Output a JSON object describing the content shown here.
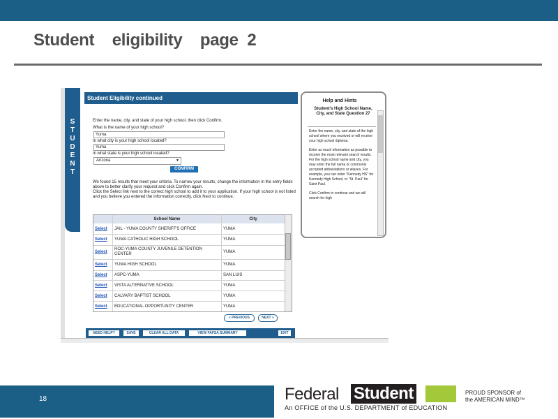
{
  "slide": {
    "title": "Student    eligibility    page  2",
    "page_number": "18"
  },
  "form": {
    "header": "Student Eligibility continued",
    "sidebar_letters": [
      "S",
      "T",
      "U",
      "D",
      "E",
      "N",
      "T"
    ],
    "instruction": "Enter the name, city, and state of your high school, then click Confirm.",
    "q_name": "What is the name of your high school?",
    "q_name_value": "Yuma",
    "q_city": "In what city is your high school located?",
    "q_city_value": "Yuma",
    "q_state": "In what state is your high school located?",
    "q_state_value": "Arizona",
    "confirm_label": "CONFIRM",
    "results_text": "We found 15 results that meet your criteria. To narrow your results, change the information in the entry fields above to better clarify your request and click Confirm again.",
    "select_help": "Click the Select link next to the correct high school to add it to your application. If your high school is not listed and you believe you entered the information correctly, click Next to continue.",
    "table": {
      "headers": [
        "School Name",
        "City"
      ],
      "select_label": "Select",
      "rows": [
        {
          "name": "JAIL - YUMA COUNTY SHERIFF'S OFFICE",
          "city": "YUMA"
        },
        {
          "name": "YUMA CATHOLIC HIGH SCHOOL",
          "city": "YUMA"
        },
        {
          "name": "ROC-YUMA COUNTY JUVENILE DETENTION CENTER",
          "city": "YUMA"
        },
        {
          "name": "YUMA HIGH SCHOOL",
          "city": "YUMA"
        },
        {
          "name": "ASPC-YUMA",
          "city": "SAN LUIS"
        },
        {
          "name": "VISTA ALTERNATIVE SCHOOL",
          "city": "YUMA"
        },
        {
          "name": "CALVARY BAPTIST SCHOOL",
          "city": "YUMA"
        },
        {
          "name": "EDUCATIONAL OPPORTUNITY CENTER",
          "city": "YUMA"
        }
      ]
    },
    "prev_label": "PREVIOUS",
    "next_label": "NEXT",
    "bottom_buttons": [
      "NEED HELP?",
      "SAVE",
      "CLEAR ALL DATA",
      "VIEW FAFSA SUMMARY",
      "EXIT"
    ]
  },
  "help": {
    "title": "Help and Hints",
    "question": "Student's High School Name, City, and State Question 27",
    "paragraphs": [
      "Enter the name, city, and state of the high school where you received or will receive your high school diploma.",
      "Enter as much information as possible to receive the most relevant search results. For the high school name and city, you may enter the full name or commonly accepted abbreviations or aliases. For example, you can enter \"Kennedy HS\" for Kennedy High School, or \"St. Paul\" for Saint Paul.",
      "Click Confirm to continue and we will search for high"
    ]
  },
  "footer": {
    "logo_federal": "Federal",
    "logo_student": "Student",
    "logo_sub": "An OFFICE of the U.S. DEPARTMENT of EDUCATION",
    "sponsor_line1": "PROUD SPONSOR of",
    "sponsor_line2": "the AMERICAN MIND™"
  },
  "colors": {
    "brand_blue": "#1b5e86",
    "link_blue": "#1f53b5",
    "logo_green": "#a3c93a"
  }
}
